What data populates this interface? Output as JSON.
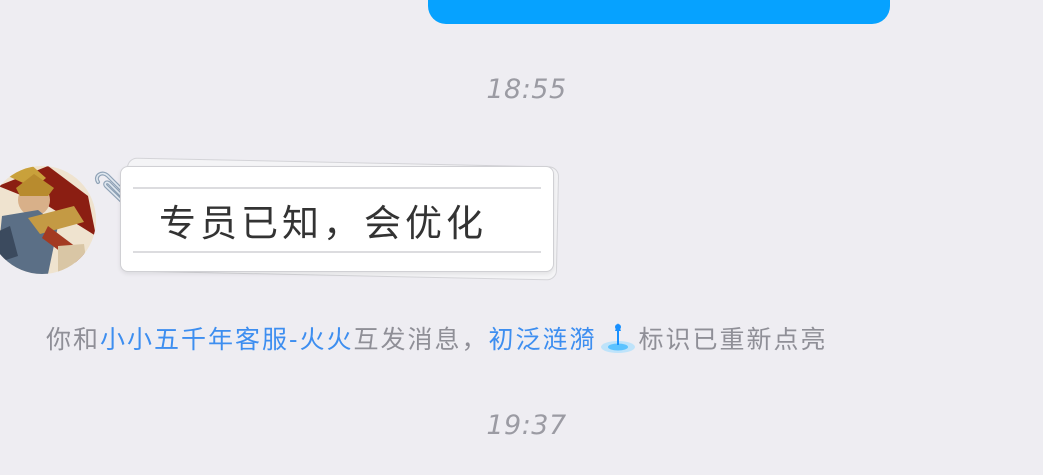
{
  "top_bubble": {
    "color": "#06a2ff"
  },
  "timestamps": [
    "18:55",
    "19:37"
  ],
  "message": {
    "sender_avatar": "game-character-avatar",
    "text": "专员已知，会优化"
  },
  "notice": {
    "prefix": "你和",
    "contact_name": "小小五千年客服-火火",
    "middle": "互发消息，",
    "badge_name": "初泛涟漪",
    "badge_icon": "ripple-water-icon",
    "suffix": "标识已重新点亮",
    "link_color": "#3d8ef0"
  }
}
